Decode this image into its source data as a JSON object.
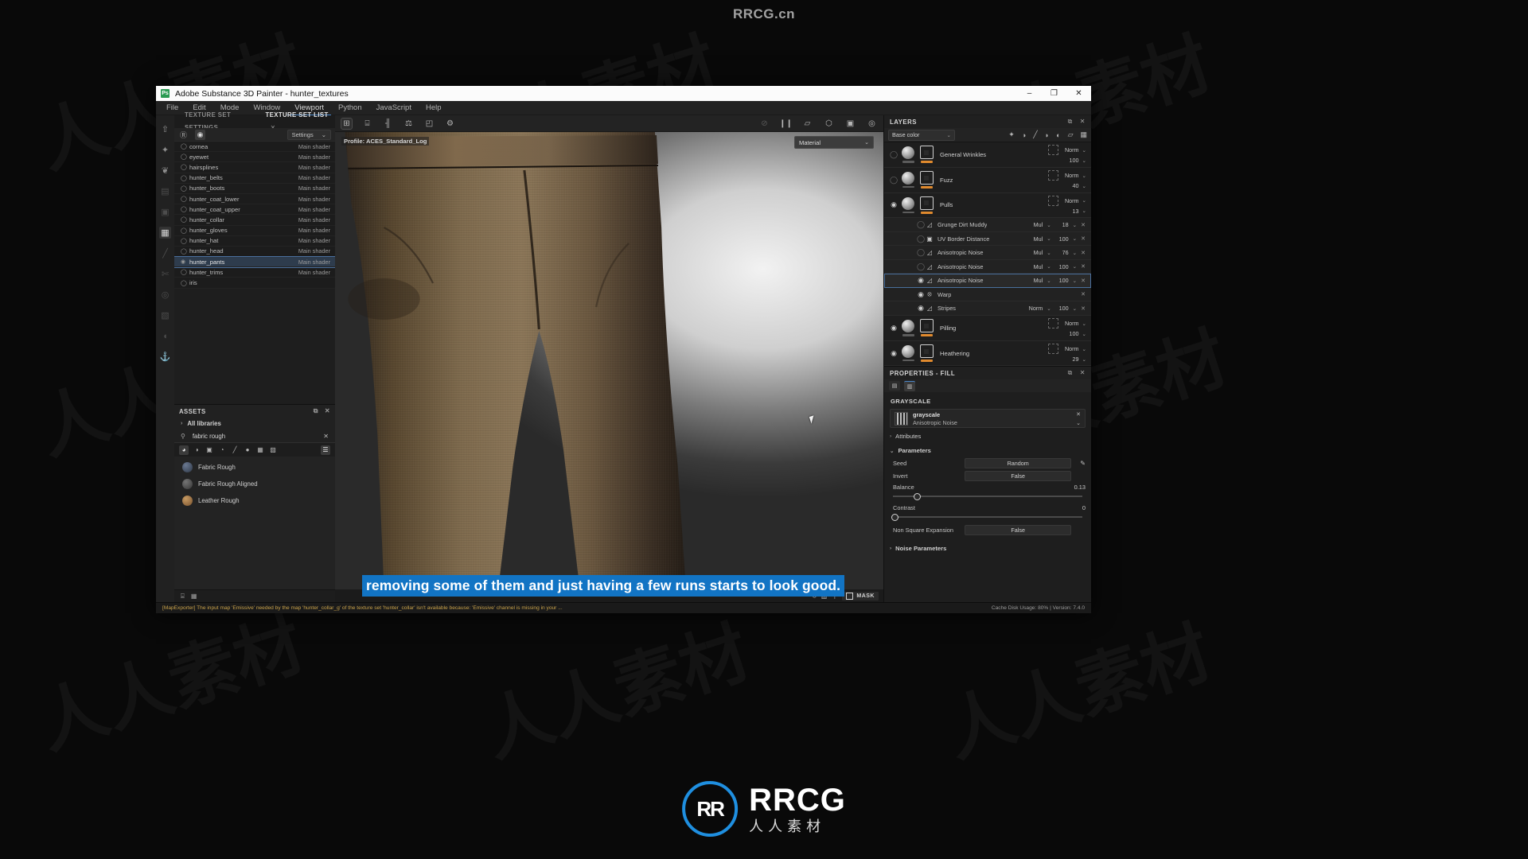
{
  "watermarks": {
    "top": "RRCG.cn",
    "brand_main": "RRCG",
    "brand_sub": "人人素材",
    "brand_mark": "RR",
    "tile_text": "人人素材"
  },
  "window": {
    "title": "Adobe Substance 3D Painter - hunter_textures",
    "app_badge": "Ps",
    "minimize": "–",
    "maximize": "❐",
    "close": "✕"
  },
  "menubar": {
    "items": [
      {
        "label": "File",
        "highlight": false
      },
      {
        "label": "Edit",
        "highlight": false
      },
      {
        "label": "Mode",
        "highlight": false
      },
      {
        "label": "Window",
        "highlight": false
      },
      {
        "label": "Viewport",
        "highlight": true
      },
      {
        "label": "Python",
        "highlight": false
      },
      {
        "label": "JavaScript",
        "highlight": false
      },
      {
        "label": "Help",
        "highlight": false
      }
    ]
  },
  "left_rail": {
    "icons": [
      {
        "name": "export-icon",
        "glyph": "⇧",
        "state": "normal"
      },
      {
        "name": "bake-icon",
        "glyph": "✦",
        "state": "normal"
      },
      {
        "name": "smart-material-icon",
        "glyph": "❦",
        "state": "normal"
      },
      {
        "name": "texture-set-icon",
        "glyph": "▤",
        "state": "dim"
      },
      {
        "name": "display-settings-icon",
        "glyph": "▣",
        "state": "dim"
      },
      {
        "name": "shelf-icon",
        "glyph": "▦",
        "state": "active"
      },
      {
        "name": "paint-brush-icon",
        "glyph": "╱",
        "state": "dim"
      },
      {
        "name": "eraser-icon",
        "glyph": "✄",
        "state": "dim"
      },
      {
        "name": "projection-icon",
        "glyph": "◎",
        "state": "dim"
      },
      {
        "name": "geometry-decal-icon",
        "glyph": "▧",
        "state": "dim"
      },
      {
        "name": "smudge-icon",
        "glyph": "◖",
        "state": "dim"
      },
      {
        "name": "clone-icon",
        "glyph": "⚓",
        "state": "dim"
      }
    ]
  },
  "texture_set_panel": {
    "tabs": [
      {
        "label": "TEXTURE SET SETTINGS",
        "active": false,
        "closable": false
      },
      {
        "label": "TEXTURE SET LIST",
        "active": true,
        "closable": true
      }
    ],
    "close_glyph": "✕",
    "toolbar": {
      "reset_icon_glyph": "Ⓡ",
      "visibility_icon_glyph": "◉",
      "settings_label": "Settings",
      "settings_caret": "⌄"
    },
    "shader_label": "Main shader",
    "rows": [
      {
        "name": "cornea",
        "shader": "Main shader",
        "selected": false,
        "visible": false
      },
      {
        "name": "eyewet",
        "shader": "Main shader",
        "selected": false,
        "visible": false
      },
      {
        "name": "hairsplines",
        "shader": "Main shader",
        "selected": false,
        "visible": false
      },
      {
        "name": "hunter_belts",
        "shader": "Main shader",
        "selected": false,
        "visible": false
      },
      {
        "name": "hunter_boots",
        "shader": "Main shader",
        "selected": false,
        "visible": false
      },
      {
        "name": "hunter_coat_lower",
        "shader": "Main shader",
        "selected": false,
        "visible": false
      },
      {
        "name": "hunter_coat_upper",
        "shader": "Main shader",
        "selected": false,
        "visible": false
      },
      {
        "name": "hunter_collar",
        "shader": "Main shader",
        "selected": false,
        "visible": false
      },
      {
        "name": "hunter_gloves",
        "shader": "Main shader",
        "selected": false,
        "visible": false
      },
      {
        "name": "hunter_hat",
        "shader": "Main shader",
        "selected": false,
        "visible": false
      },
      {
        "name": "hunter_head",
        "shader": "Main shader",
        "selected": false,
        "visible": false
      },
      {
        "name": "hunter_pants",
        "shader": "Main shader",
        "selected": true,
        "visible": true
      },
      {
        "name": "hunter_trims",
        "shader": "Main shader",
        "selected": false,
        "visible": false
      },
      {
        "name": "iris",
        "shader": "",
        "selected": false,
        "visible": false
      }
    ]
  },
  "assets_panel": {
    "title": "ASSETS",
    "float_glyph": "⧉",
    "close_glyph": "✕",
    "library_label": "All libraries",
    "library_caret": "›",
    "search": {
      "value": "fabric rough",
      "placeholder": "Search",
      "magnifier": "⚲",
      "clear": "✕"
    },
    "filters": [
      {
        "name": "filter-materials-icon",
        "glyph": "◕",
        "active": true
      },
      {
        "name": "filter-smart-materials-icon",
        "glyph": "◑",
        "active": false
      },
      {
        "name": "filter-masks-icon",
        "glyph": "▣",
        "active": false
      },
      {
        "name": "filter-smart-masks-icon",
        "glyph": "◔",
        "active": false
      },
      {
        "name": "filter-brushes-icon",
        "glyph": "╱",
        "active": false
      },
      {
        "name": "filter-alphas-icon",
        "glyph": "●",
        "active": false
      },
      {
        "name": "filter-textures-icon",
        "glyph": "▦",
        "active": false
      },
      {
        "name": "filter-environments-icon",
        "glyph": "▨",
        "active": false
      }
    ],
    "view_toggle_glyph": "☰",
    "items": [
      {
        "label": "Fabric Rough",
        "color": "#3c4758"
      },
      {
        "label": "Fabric Rough Aligned",
        "color": "#4a4a4a"
      },
      {
        "label": "Leather Rough",
        "color": "#9a6f45"
      }
    ],
    "footer_icons": [
      {
        "name": "list-view-icon",
        "glyph": "⌸"
      },
      {
        "name": "grid-view-icon",
        "glyph": "▦"
      }
    ]
  },
  "viewport": {
    "toolbar_left": [
      {
        "name": "toggle-view-icon",
        "glyph": "⊞",
        "boxed": true
      },
      {
        "name": "uv-grid-icon",
        "glyph": "⌸",
        "boxed": false
      },
      {
        "name": "symmetry-icon",
        "glyph": "╢",
        "boxed": false
      },
      {
        "name": "balance-icon",
        "glyph": "⚖",
        "boxed": false
      },
      {
        "name": "fill-icon",
        "glyph": "◰",
        "boxed": false
      },
      {
        "name": "settings-gear-icon",
        "glyph": "⚙",
        "boxed": false
      }
    ],
    "toolbar_right": [
      {
        "name": "hide-display-icon",
        "glyph": "⊘",
        "dim": true
      },
      {
        "name": "pause-engine-icon",
        "glyph": "❙❙",
        "dim": false
      },
      {
        "name": "perspective-camera-icon",
        "glyph": "▱",
        "dim": false
      },
      {
        "name": "shading-icon",
        "glyph": "⬡",
        "dim": false
      },
      {
        "name": "video-icon",
        "glyph": "▣",
        "dim": false
      },
      {
        "name": "screenshot-icon",
        "glyph": "◎",
        "dim": false
      }
    ],
    "profile_label": "Profile: ACES_Standard_Log",
    "material_selector": {
      "value": "Material",
      "caret": "⌄"
    },
    "mask_chip": "MASK",
    "bottom_icons": [
      {
        "name": "mesh-reload-icon",
        "glyph": "↺"
      },
      {
        "name": "new-document-icon",
        "glyph": "▧"
      },
      {
        "name": "add-icon",
        "glyph": "＋"
      }
    ]
  },
  "layers_panel": {
    "title": "LAYERS",
    "float_glyph": "⧉",
    "close_glyph": "✕",
    "channel": {
      "value": "Base color",
      "caret": "⌄"
    },
    "toolbar_icons": [
      {
        "name": "add-effect-icon",
        "glyph": "✦"
      },
      {
        "name": "add-mask-icon",
        "glyph": "◑"
      },
      {
        "name": "add-paint-layer-icon",
        "glyph": "╱"
      },
      {
        "name": "add-fill-layer-icon",
        "glyph": "◗"
      },
      {
        "name": "add-group-icon",
        "glyph": "◐"
      },
      {
        "name": "add-folder-icon",
        "glyph": "▱"
      },
      {
        "name": "delete-layer-icon",
        "glyph": "Ὕ1"
      }
    ],
    "rows": [
      {
        "type": "layer",
        "name": "General Wrinkles",
        "visible": false,
        "blend": "Norm",
        "opacity": "100",
        "selected": false,
        "icon": "folder-icon"
      },
      {
        "type": "layer",
        "name": "Fuzz",
        "visible": false,
        "blend": "Norm",
        "opacity": "40",
        "selected": false,
        "icon": "folder-icon"
      },
      {
        "type": "layer",
        "name": "Pulls",
        "visible": true,
        "blend": "Norm",
        "opacity": "13",
        "selected": false,
        "icon": "folder-icon"
      },
      {
        "type": "effect",
        "name": "Grunge Dirt Muddy",
        "visible": false,
        "blend": "Mul",
        "opacity": "18",
        "selected": false,
        "icon": "fill-effect-icon"
      },
      {
        "type": "effect",
        "name": "UV Border Distance",
        "visible": false,
        "blend": "Mul",
        "opacity": "100",
        "selected": false,
        "icon": "generator-icon"
      },
      {
        "type": "effect",
        "name": "Anisotropic Noise",
        "visible": false,
        "blend": "Mul",
        "opacity": "76",
        "selected": false,
        "icon": "fill-effect-icon"
      },
      {
        "type": "effect",
        "name": "Anisotropic Noise",
        "visible": false,
        "blend": "Mul",
        "opacity": "100",
        "selected": false,
        "icon": "fill-effect-icon"
      },
      {
        "type": "effect",
        "name": "Anisotropic Noise",
        "visible": true,
        "blend": "Mul",
        "opacity": "100",
        "selected": true,
        "icon": "fill-effect-icon"
      },
      {
        "type": "effect",
        "name": "Warp",
        "visible": true,
        "blend": "",
        "opacity": "",
        "selected": false,
        "icon": "warp-filter-icon"
      },
      {
        "type": "effect",
        "name": "Stripes",
        "visible": true,
        "blend": "Norm",
        "opacity": "100",
        "selected": false,
        "icon": "fill-effect-icon"
      },
      {
        "type": "layer",
        "name": "Pilling",
        "visible": true,
        "blend": "Norm",
        "opacity": "100",
        "selected": false,
        "icon": "folder-icon"
      },
      {
        "type": "layer",
        "name": "Heathering",
        "visible": true,
        "blend": "Norm",
        "opacity": "29",
        "selected": false,
        "icon": "folder-icon"
      }
    ],
    "blend_caret": "⌄",
    "remove_glyph": "✕"
  },
  "properties_panel": {
    "title": "PROPERTIES - FILL",
    "float_glyph": "⧉",
    "close_glyph": "✕",
    "tabs": [
      {
        "name": "material-properties-tab",
        "glyph": "▤",
        "active": false
      },
      {
        "name": "grayscale-properties-tab",
        "glyph": "▥",
        "active": true
      }
    ],
    "section_label": "GRAYSCALE",
    "resource": {
      "channel": "grayscale",
      "name": "Anisotropic Noise",
      "clear_glyph": "✕",
      "caret_glyph": "⌄"
    },
    "accordions": [
      {
        "label": "Attributes",
        "caret": "›",
        "expanded": false
      },
      {
        "label": "Parameters",
        "caret": "⌄",
        "expanded": true
      }
    ],
    "parameters": [
      {
        "label": "Seed",
        "kind": "button",
        "value": "Random",
        "has_pencil": true
      },
      {
        "label": "Invert",
        "kind": "button",
        "value": "False",
        "has_pencil": false
      },
      {
        "label": "Balance",
        "kind": "slider",
        "value": "0.13",
        "percent": 13
      },
      {
        "label": "Contrast",
        "kind": "slider",
        "value": "0",
        "percent": 0
      },
      {
        "label": "Non Square Expansion",
        "kind": "button",
        "value": "False",
        "has_pencil": false
      }
    ],
    "noise_parameters": {
      "label": "Noise Parameters",
      "caret": "›"
    }
  },
  "statusbar": {
    "message": "[MapExporter] The input map 'Emissive' needed by the map 'hunter_collar_g' of the texture set 'hunter_collar' isn't available because: 'Emissive' channel is missing in your ...",
    "right": "Cache Disk Usage:   80% | Version: 7.4.0"
  },
  "subtitle": {
    "text": "removing some of them and just having a few runs starts to look good."
  },
  "colors": {
    "accent_blue": "#1274c4",
    "selection_blue": "#4a6f9c",
    "opacity_orange": "#e08a2e",
    "warning_yellow": "#c9a24a",
    "logo_blue": "#1f8fe0"
  }
}
